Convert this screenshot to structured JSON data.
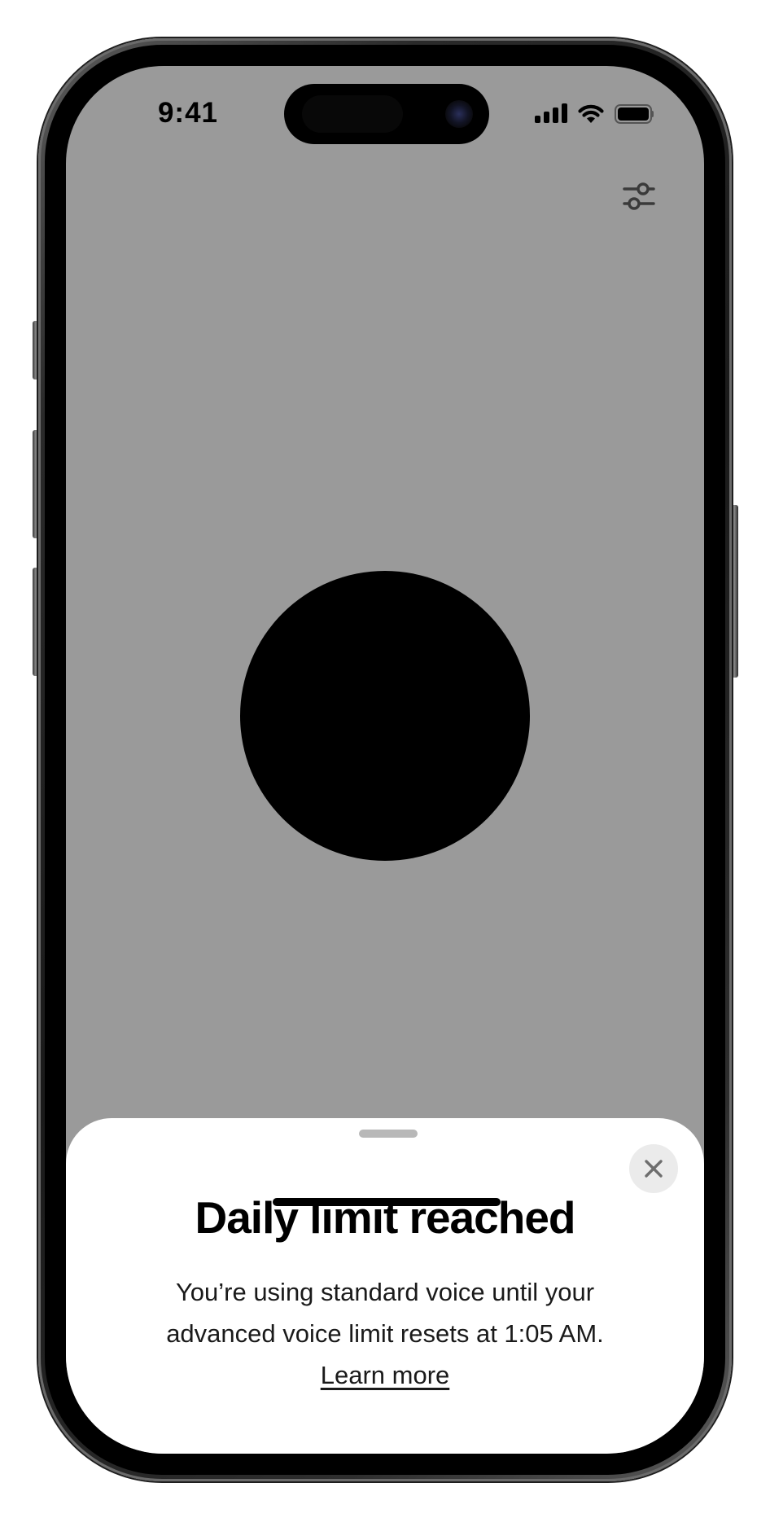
{
  "status_bar": {
    "time": "9:41",
    "icons": [
      "cellular-signal-icon",
      "wifi-icon",
      "battery-icon"
    ]
  },
  "toolbar": {
    "settings_icon": "sliders-settings-icon"
  },
  "voice_orb": {
    "color": "#000000"
  },
  "background_color": "#9a9a9a",
  "sheet": {
    "close_icon": "close-icon",
    "title": "Daily limit reached",
    "body": "You’re using standard voice until your advanced voice limit resets at 1:05 AM.",
    "link_label": "Learn more"
  }
}
